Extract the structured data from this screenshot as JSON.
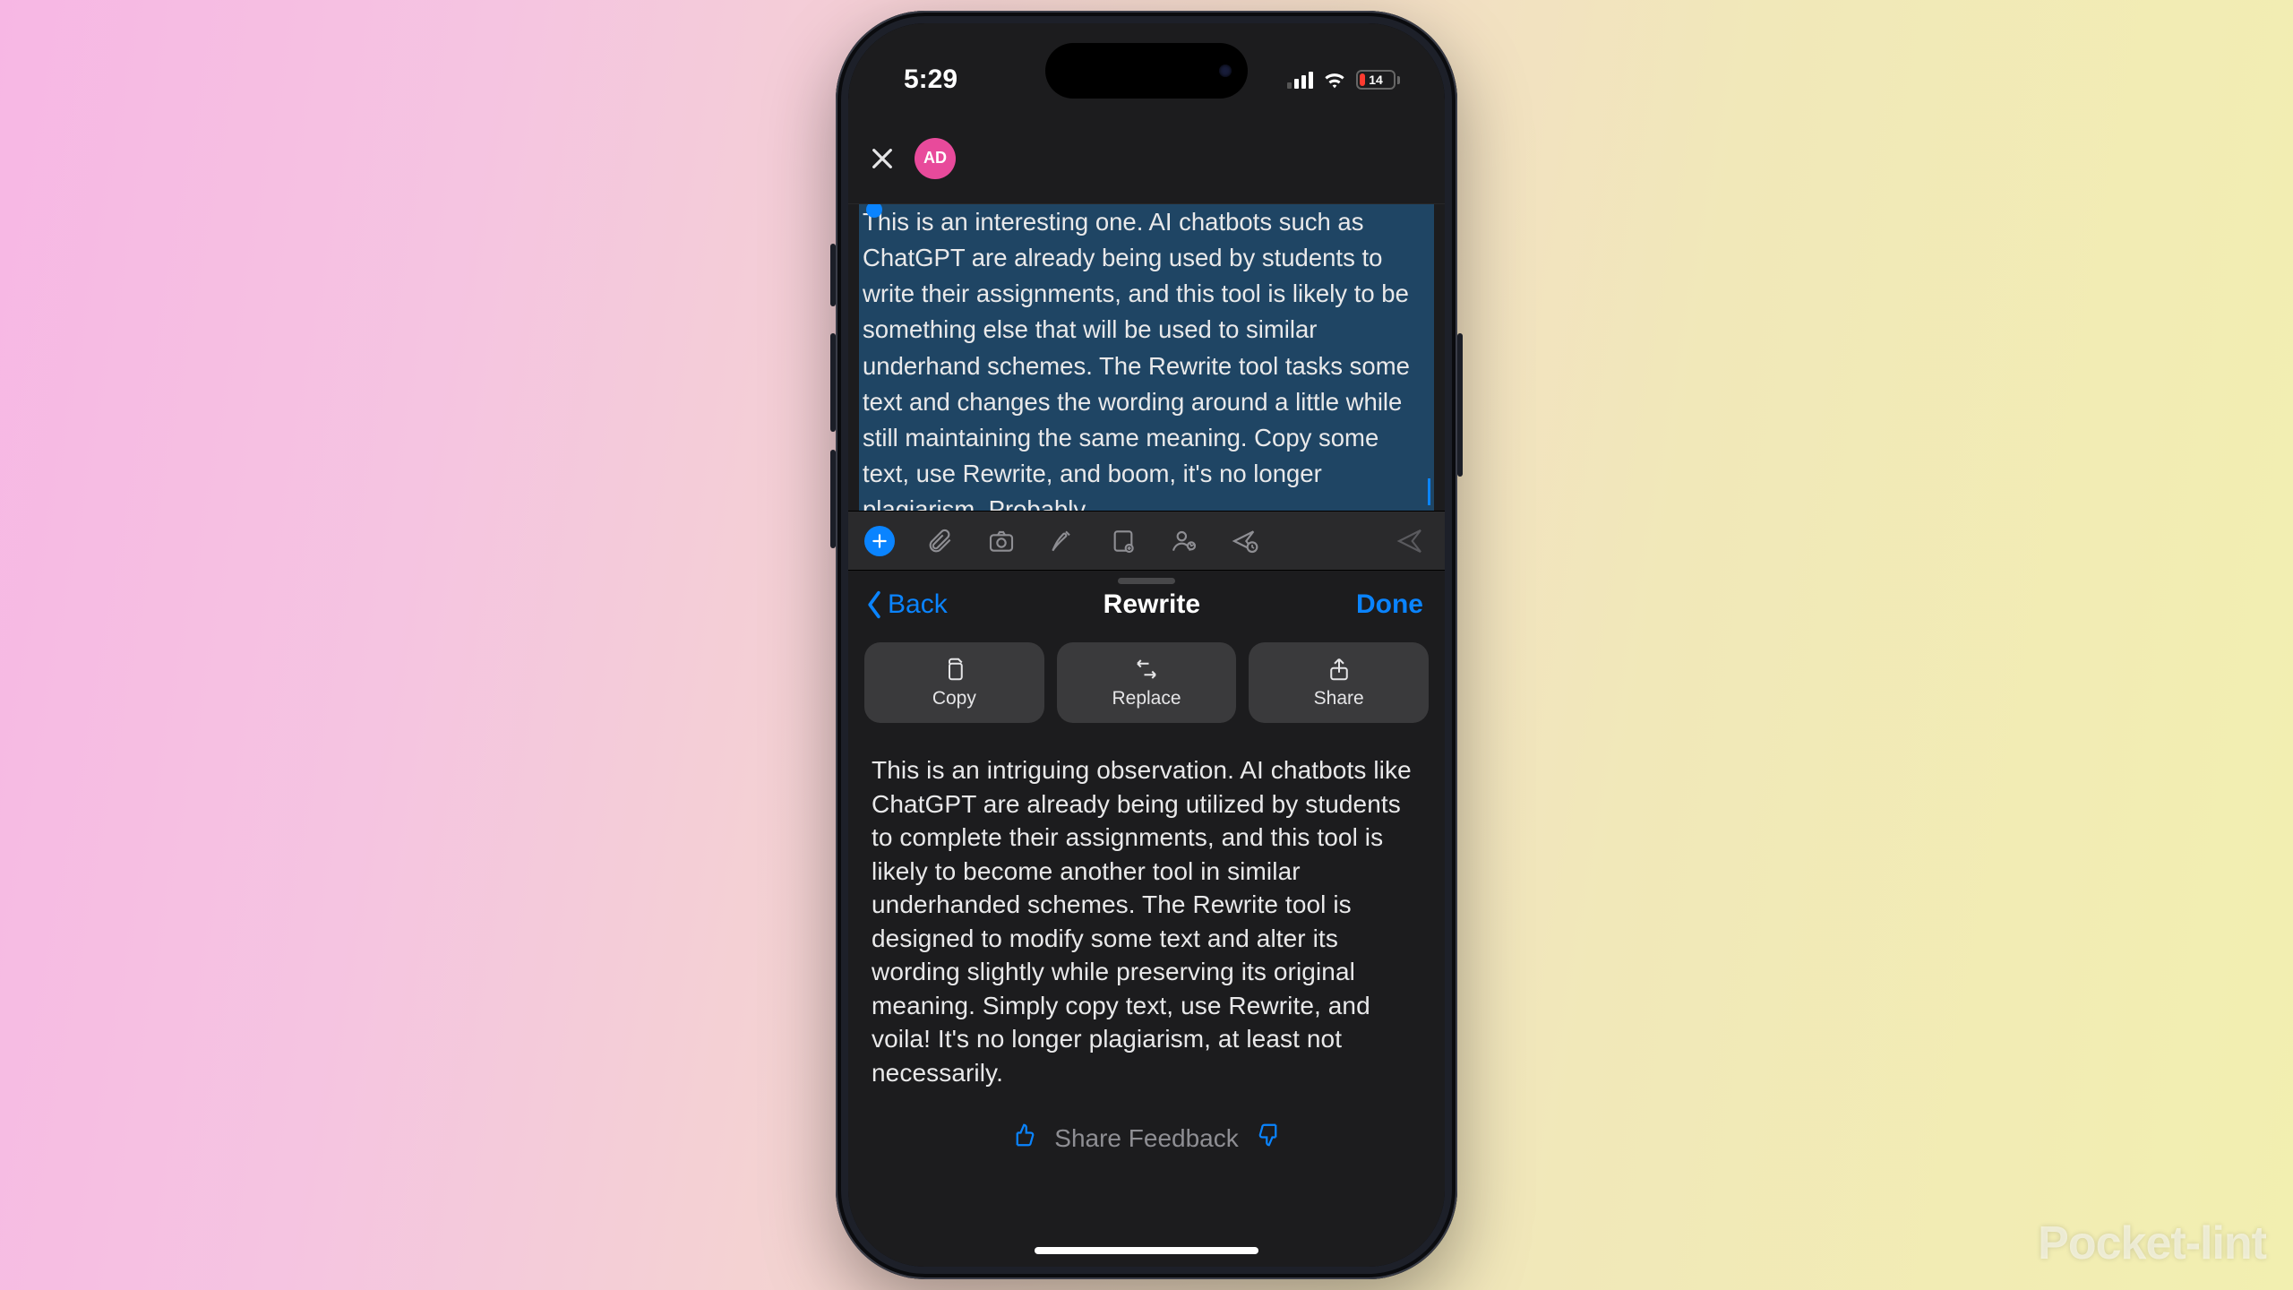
{
  "watermark": "Pocket-lint",
  "status": {
    "time": "5:29",
    "battery_pct": "14"
  },
  "header": {
    "avatar_initials": "AD"
  },
  "compose": {
    "selected_text": "This is an interesting one. AI chatbots such as ChatGPT are already being used by students to write their assignments, and this tool is likely to be something else that will be used to similar underhand schemes. The Rewrite tool tasks some text and changes the wording around a little while still maintaining the same meaning. Copy some text, use Rewrite, and boom, it's no longer plagiarism. Probably."
  },
  "sheet": {
    "back_label": "Back",
    "title": "Rewrite",
    "done_label": "Done",
    "actions": {
      "copy": "Copy",
      "replace": "Replace",
      "share": "Share"
    },
    "result_text": "This is an intriguing observation. AI chatbots like ChatGPT are already being utilized by students to complete their assignments, and this tool is likely to become another tool in similar underhanded schemes. The Rewrite tool is designed to modify some text and alter its wording slightly while preserving its original meaning. Simply copy text, use Rewrite, and voila! It's no longer plagiarism, at least not necessarily.",
    "feedback_label": "Share Feedback"
  }
}
